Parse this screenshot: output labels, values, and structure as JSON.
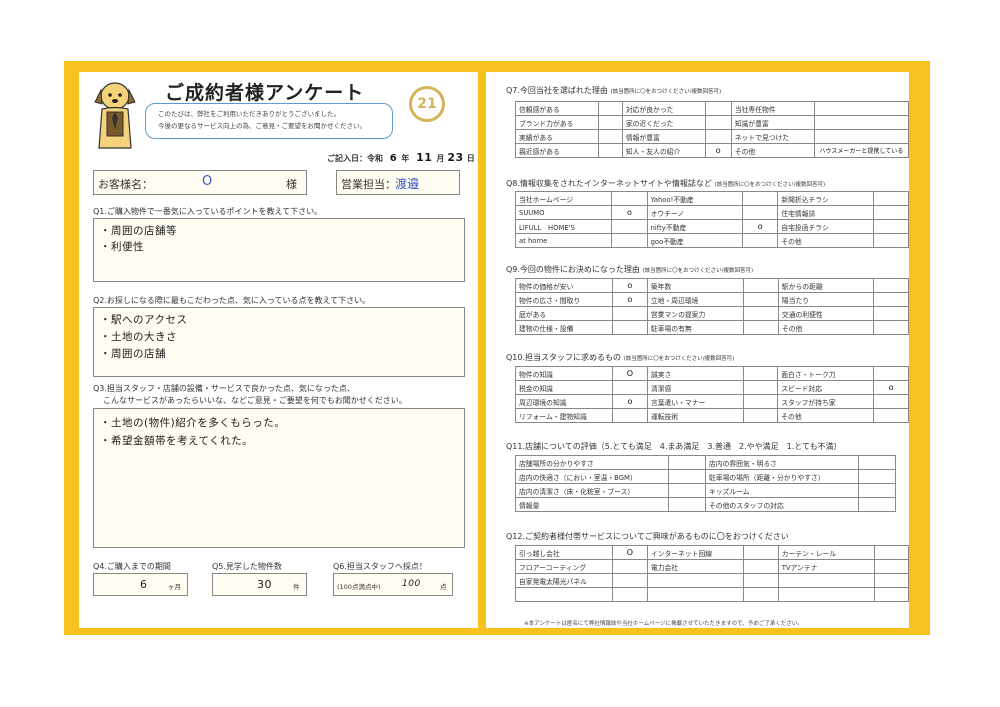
{
  "header": {
    "title": "ご成約者様アンケート",
    "greeting_line1": "このたびは、弊社をご利用いただきありがとうございました。",
    "greeting_line2": "今後の更なるサービス向上の為、ご意見・ご要望をお聞かせください。",
    "logo_text": "21",
    "date_label": "ご記入日：令和",
    "date_year": "6",
    "date_year_unit": "年",
    "date_month": "11",
    "date_month_unit": "月",
    "date_day": "23",
    "date_day_unit": "日"
  },
  "customer": {
    "name_label": "お客様名：",
    "name_value": "O",
    "name_suffix": "様",
    "staff_label": "営業担当：",
    "staff_value": "渡邉"
  },
  "q1": {
    "question": "Q1.ご購入物件で一番気に入っているポイントを教えて下さい。",
    "answers": [
      "・周囲の店舗等",
      "・利便性"
    ]
  },
  "q2": {
    "question": "Q2.お探しになる際に最もこだわった点、気に入っている点を教えて下さい。",
    "answers": [
      "・駅へのアクセス",
      "・土地の大きさ",
      "・周囲の店舗"
    ]
  },
  "q3": {
    "question_line1": "Q3.担当スタッフ・店舗の設備・サービスで良かった点、気になった点、",
    "question_line2": "こんなサービスがあったらいいな、などご意見・ご要望を何でもお聞かせください。",
    "answers": [
      "・土地の(物件)紹介を多くもらった。",
      "・希望金額帯を考えてくれた。"
    ]
  },
  "q4": {
    "question": "Q4.ご購入までの期間",
    "value": "6",
    "unit": "ヶ月"
  },
  "q5": {
    "question": "Q5.見学した物件数",
    "value": "30",
    "unit": "件"
  },
  "q6": {
    "question": "Q6.担当スタッフへ採点！",
    "prefix": "(100点満点中)",
    "value": "100",
    "unit": "点"
  },
  "q7": {
    "question": "Q7.今回当社を選ばれた理由",
    "note": "(該当箇所に〇をおつけください/複数回答可)",
    "rows": [
      [
        {
          "label": "信頼感がある",
          "mark": ""
        },
        {
          "label": "対応が良かった",
          "mark": ""
        },
        {
          "label": "当社専任物件",
          "mark": ""
        }
      ],
      [
        {
          "label": "ブランド力がある",
          "mark": ""
        },
        {
          "label": "家の近くだった",
          "mark": ""
        },
        {
          "label": "知識が豊富",
          "mark": ""
        }
      ],
      [
        {
          "label": "実績がある",
          "mark": ""
        },
        {
          "label": "情報が豊富",
          "mark": ""
        },
        {
          "label": "ネットで見つけた",
          "mark": ""
        }
      ],
      [
        {
          "label": "親近感がある",
          "mark": ""
        },
        {
          "label": "知人・友人の紹介",
          "mark": "o"
        },
        {
          "label": "その他",
          "mark": "ハウスメーカーと提携している"
        }
      ]
    ]
  },
  "q8": {
    "question": "Q8.情報収集をされたインターネットサイトや情報誌など",
    "note": "(該当箇所に〇をおつけください/複数回答可)",
    "rows": [
      [
        {
          "label": "当社ホームページ",
          "mark": ""
        },
        {
          "label": "Yahoo!不動産",
          "mark": ""
        },
        {
          "label": "新聞折込チラシ",
          "mark": ""
        }
      ],
      [
        {
          "label": "SUUMO",
          "mark": "o"
        },
        {
          "label": "オウチーノ",
          "mark": ""
        },
        {
          "label": "住宅情報誌",
          "mark": ""
        }
      ],
      [
        {
          "label": "LIFULL　HOME'S",
          "mark": ""
        },
        {
          "label": "nifty不動産",
          "mark": "o"
        },
        {
          "label": "自宅投函チラシ",
          "mark": ""
        }
      ],
      [
        {
          "label": "at home",
          "mark": ""
        },
        {
          "label": "goo不動産",
          "mark": ""
        },
        {
          "label": "その他",
          "mark": ""
        }
      ]
    ]
  },
  "q9": {
    "question": "Q9.今回の物件にお決めになった理由",
    "note": "(該当箇所に〇をおつけください/複数回答可)",
    "rows": [
      [
        {
          "label": "物件の価格が安い",
          "mark": "o"
        },
        {
          "label": "築年数",
          "mark": ""
        },
        {
          "label": "駅からの距離",
          "mark": ""
        }
      ],
      [
        {
          "label": "物件の広さ・間取り",
          "mark": "o"
        },
        {
          "label": "立地・周辺環境",
          "mark": ""
        },
        {
          "label": "陽当たり",
          "mark": ""
        }
      ],
      [
        {
          "label": "庭がある",
          "mark": ""
        },
        {
          "label": "営業マンの提案力",
          "mark": ""
        },
        {
          "label": "交通の利便性",
          "mark": ""
        }
      ],
      [
        {
          "label": "建物の仕様・設備",
          "mark": ""
        },
        {
          "label": "駐車場の有無",
          "mark": ""
        },
        {
          "label": "その他",
          "mark": ""
        }
      ]
    ]
  },
  "q10": {
    "question": "Q10.担当スタッフに求めるもの",
    "note": "(該当箇所に〇をおつけください/複数回答可)",
    "rows": [
      [
        {
          "label": "物件の知識",
          "mark": "O"
        },
        {
          "label": "誠実さ",
          "mark": ""
        },
        {
          "label": "面白さ・トーク力",
          "mark": ""
        }
      ],
      [
        {
          "label": "税金の知識",
          "mark": ""
        },
        {
          "label": "清潔感",
          "mark": ""
        },
        {
          "label": "スピード対応",
          "mark": "o"
        }
      ],
      [
        {
          "label": "周辺環境の知識",
          "mark": "o"
        },
        {
          "label": "言葉遣い・マナー",
          "mark": ""
        },
        {
          "label": "スタッフが持ち家",
          "mark": ""
        }
      ],
      [
        {
          "label": "リフォーム・建物知識",
          "mark": ""
        },
        {
          "label": "運転技術",
          "mark": ""
        },
        {
          "label": "その他",
          "mark": ""
        }
      ]
    ]
  },
  "q11": {
    "question": "Q11.店舗についての評価（5.とても満足　4.まあ満足　3.普通　2.やや満足　1.とても不満）",
    "rows": [
      [
        {
          "label": "店舗場所の分かりやすさ",
          "mark": ""
        },
        {
          "label": "店内の雰囲気・明るさ",
          "mark": ""
        }
      ],
      [
        {
          "label": "店内の快適さ（におい・室温・BGM）",
          "mark": ""
        },
        {
          "label": "駐車場の場所（距離・分かりやすさ）",
          "mark": ""
        }
      ],
      [
        {
          "label": "店内の清潔さ（床・化粧室・ブース）",
          "mark": ""
        },
        {
          "label": "キッズルーム",
          "mark": ""
        }
      ],
      [
        {
          "label": "情報量",
          "mark": ""
        },
        {
          "label": "その他のスタッフの対応",
          "mark": ""
        }
      ]
    ]
  },
  "q12": {
    "question": "Q12.ご契約者様付帯サービスについてご興味があるものに〇をおつけください",
    "rows": [
      [
        {
          "label": "引っ越し会社",
          "mark": "O"
        },
        {
          "label": "インターネット回線",
          "mark": ""
        },
        {
          "label": "カーテン・レール",
          "mark": ""
        }
      ],
      [
        {
          "label": "フロアーコーティング",
          "mark": ""
        },
        {
          "label": "電力会社",
          "mark": ""
        },
        {
          "label": "TVアンテナ",
          "mark": ""
        }
      ],
      [
        {
          "label": "自家発電太陽光パネル",
          "mark": ""
        },
        {
          "label": "",
          "mark": ""
        },
        {
          "label": "",
          "mark": ""
        }
      ],
      [
        {
          "label": "",
          "mark": ""
        },
        {
          "label": "",
          "mark": ""
        },
        {
          "label": "",
          "mark": ""
        }
      ]
    ]
  },
  "footer": {
    "note": "※本アンケートは匿名にて弊社情報誌や当社ホームページに掲載させていただきますので、予めご了承ください。"
  }
}
